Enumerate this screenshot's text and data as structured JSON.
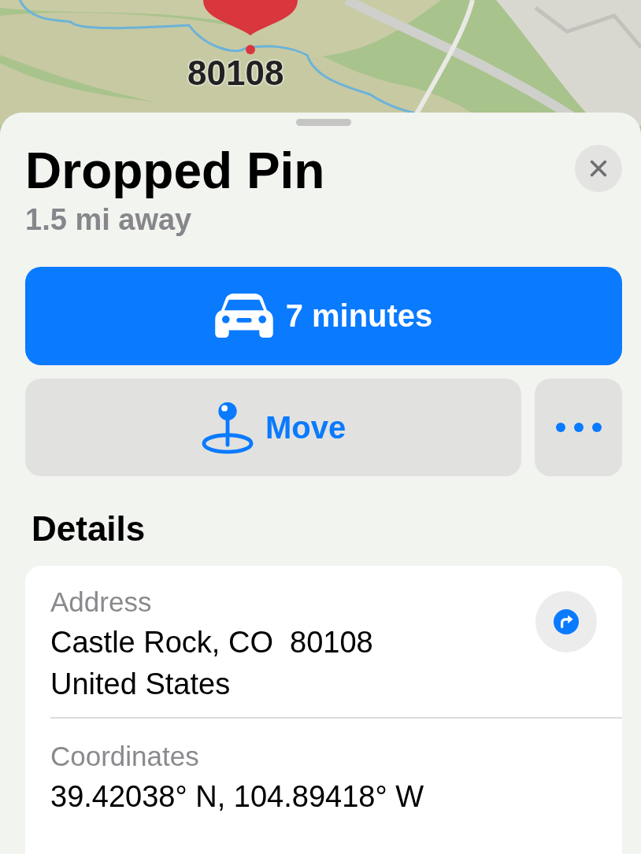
{
  "map": {
    "pin": {
      "label": "80108"
    }
  },
  "sheet": {
    "title": "Dropped Pin",
    "subtitle": "1.5 mi away",
    "directions_button": {
      "label": "7 minutes"
    },
    "move_button": {
      "label": "Move"
    },
    "section_title": "Details",
    "details": [
      {
        "label": "Address",
        "value_lines": [
          "Castle Rock, CO  80108",
          "United States"
        ],
        "has_action": true
      },
      {
        "label": "Coordinates",
        "value_lines": [
          "39.42038° N, 104.89418° W"
        ],
        "has_action": false
      }
    ]
  }
}
